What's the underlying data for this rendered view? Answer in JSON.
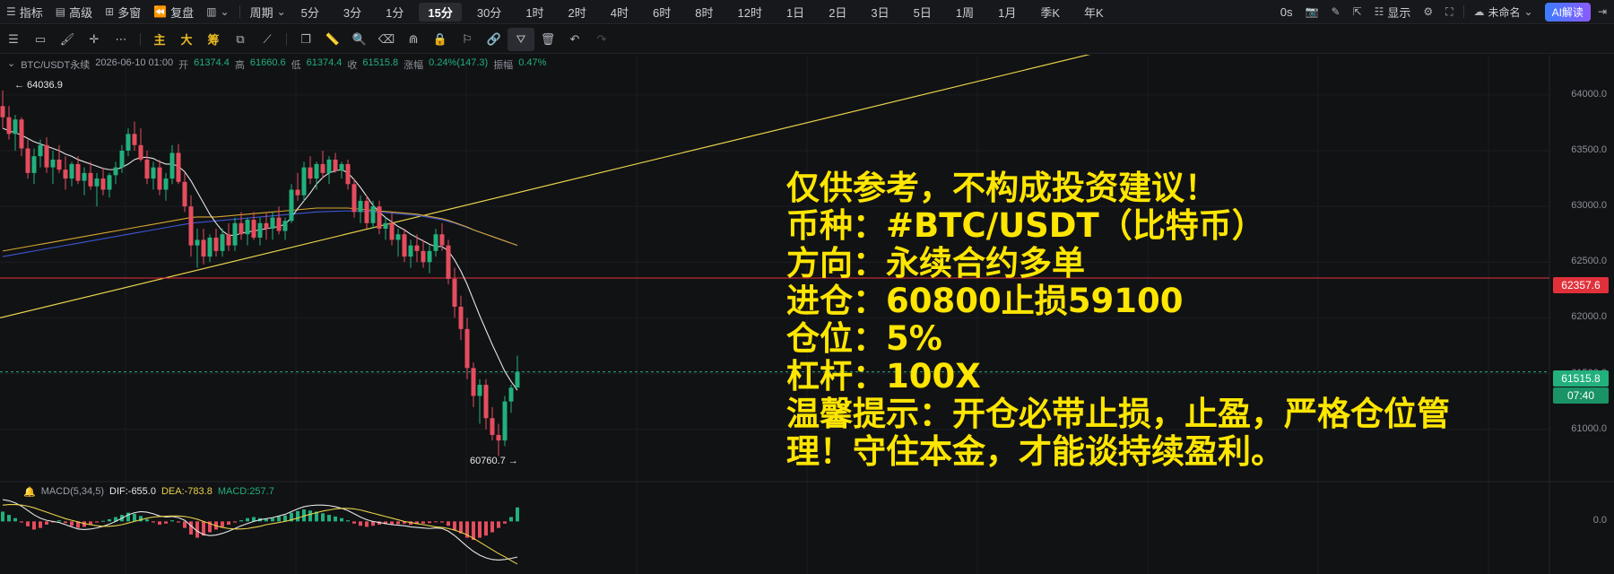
{
  "toolbar": {
    "indicators": "指标",
    "advanced": "高级",
    "multi_window": "多窗",
    "replay": "复盘",
    "period": "周期",
    "periods": [
      "5分",
      "3分",
      "1分",
      "15分",
      "30分",
      "1时",
      "2时",
      "4时",
      "6时",
      "8时",
      "12时",
      "1日",
      "2日",
      "3日",
      "5日",
      "1周",
      "1月",
      "季K",
      "年K"
    ],
    "active_period": "15分",
    "countdown": "0s",
    "display": "显示",
    "layout_name": "未命名",
    "ai_button": "AI解读"
  },
  "drawing_tools": {
    "main": "主",
    "big": "大",
    "chips": "筹"
  },
  "legend": {
    "symbol": "BTC/USDT永续",
    "datetime": "2026-06-10 01:00",
    "open_label": "开",
    "open": "61374.4",
    "high_label": "高",
    "high": "61660.6",
    "low_label": "低",
    "low": "61374.4",
    "close_label": "收",
    "close": "61515.8",
    "change_label": "涨幅",
    "change": "0.24%(147.3)",
    "amplitude_label": "振幅",
    "amplitude": "0.47%"
  },
  "price_axis": [
    "64000.0",
    "63500.0",
    "63000.0",
    "62500.0",
    "62000.0",
    "61500.0",
    "61000.0"
  ],
  "macd_axis": "0.0",
  "tags": {
    "red_line_price": "62357.6",
    "current_price": "61515.8",
    "countdown": "07:40"
  },
  "extremes": {
    "high": "← 64036.9",
    "low": "60760.7 →"
  },
  "overlay_lines": [
    "仅供参考，不构成投资建议！",
    "币种：#BTC/USDT（比特币）",
    "方向：永续合约多单",
    "进仓：60800止损59100",
    "仓位：5%",
    "杠杆：100X",
    "温馨提示：开仓必带止损，止盈，严格仓位管",
    "理！守住本金，才能谈持续盈利。"
  ],
  "macd": {
    "name": "MACD(5,34,5)",
    "dif": "DIF:-655.0",
    "dea": "DEA:-783.8",
    "macd": "MACD:257.7"
  },
  "colors": {
    "up": "#22b07d",
    "down": "#e54d5e",
    "ma_short": "#e6e6e6",
    "ma_mid": "#d6a631",
    "ma_long": "#3b56d6",
    "trendline": "#e8d24a",
    "level_line": "#e0313b",
    "overlay_text": "#ffe600"
  },
  "price_data": {
    "ohlc": [
      [
        63900,
        64040,
        63700,
        63800
      ],
      [
        63800,
        63900,
        63600,
        63650
      ],
      [
        63650,
        63820,
        63500,
        63780
      ],
      [
        63780,
        63800,
        63450,
        63520
      ],
      [
        63520,
        63600,
        63250,
        63300
      ],
      [
        63300,
        63520,
        63200,
        63450
      ],
      [
        63450,
        63600,
        63350,
        63550
      ],
      [
        63550,
        63620,
        63300,
        63350
      ],
      [
        63350,
        63500,
        63200,
        63420
      ],
      [
        63420,
        63550,
        63300,
        63330
      ],
      [
        63330,
        63450,
        63150,
        63250
      ],
      [
        63250,
        63400,
        63180,
        63380
      ],
      [
        63380,
        63450,
        63200,
        63230
      ],
      [
        63230,
        63350,
        63100,
        63300
      ],
      [
        63300,
        63400,
        63150,
        63180
      ],
      [
        63180,
        63300,
        63000,
        63250
      ],
      [
        63250,
        63350,
        63100,
        63150
      ],
      [
        63150,
        63300,
        63080,
        63280
      ],
      [
        63280,
        63400,
        63200,
        63350
      ],
      [
        63350,
        63550,
        63300,
        63500
      ],
      [
        63500,
        63700,
        63450,
        63650
      ],
      [
        63650,
        63760,
        63500,
        63550
      ],
      [
        63550,
        63700,
        63400,
        63420
      ],
      [
        63420,
        63500,
        63200,
        63250
      ],
      [
        63250,
        63400,
        63150,
        63350
      ],
      [
        63350,
        63420,
        63100,
        63150
      ],
      [
        63150,
        63300,
        63050,
        63250
      ],
      [
        63250,
        63550,
        63200,
        63480
      ],
      [
        63480,
        63560,
        63200,
        63220
      ],
      [
        63220,
        63300,
        62950,
        63000
      ],
      [
        63000,
        63100,
        62550,
        62650
      ],
      [
        62650,
        62800,
        62450,
        62700
      ],
      [
        62700,
        62800,
        62480,
        62550
      ],
      [
        62550,
        62750,
        62500,
        62720
      ],
      [
        62720,
        62800,
        62550,
        62600
      ],
      [
        62600,
        62800,
        62550,
        62750
      ],
      [
        62750,
        62850,
        62600,
        62650
      ],
      [
        62650,
        62900,
        62600,
        62850
      ],
      [
        62850,
        62950,
        62700,
        62750
      ],
      [
        62750,
        62900,
        62650,
        62880
      ],
      [
        62880,
        62950,
        62700,
        62720
      ],
      [
        62720,
        62900,
        62650,
        62850
      ],
      [
        62850,
        62950,
        62700,
        62800
      ],
      [
        62800,
        62950,
        62700,
        62900
      ],
      [
        62900,
        63000,
        62750,
        62780
      ],
      [
        62780,
        62900,
        62700,
        62870
      ],
      [
        62870,
        63200,
        62850,
        63150
      ],
      [
        63150,
        63300,
        63050,
        63100
      ],
      [
        63100,
        63400,
        63050,
        63350
      ],
      [
        63350,
        63450,
        63200,
        63250
      ],
      [
        63250,
        63400,
        63150,
        63380
      ],
      [
        63380,
        63500,
        63250,
        63300
      ],
      [
        63300,
        63450,
        63200,
        63420
      ],
      [
        63420,
        63480,
        63300,
        63320
      ],
      [
        63320,
        63400,
        63250,
        63380
      ],
      [
        63380,
        63420,
        63150,
        63200
      ],
      [
        63200,
        63250,
        62900,
        62950
      ],
      [
        62950,
        63100,
        62850,
        63050
      ],
      [
        63050,
        63100,
        62800,
        62850
      ],
      [
        62850,
        63050,
        62800,
        63000
      ],
      [
        63000,
        63050,
        62750,
        62800
      ],
      [
        62800,
        62900,
        62700,
        62850
      ],
      [
        62850,
        62950,
        62650,
        62700
      ],
      [
        62700,
        62800,
        62550,
        62750
      ],
      [
        62750,
        62800,
        62500,
        62550
      ],
      [
        62550,
        62700,
        62450,
        62650
      ],
      [
        62650,
        62750,
        62500,
        62600
      ],
      [
        62600,
        62700,
        62450,
        62500
      ],
      [
        62500,
        62650,
        62400,
        62600
      ],
      [
        62600,
        62800,
        62550,
        62750
      ],
      [
        62750,
        62850,
        62600,
        62650
      ],
      [
        62650,
        62700,
        62300,
        62350
      ],
      [
        62350,
        62450,
        62000,
        62100
      ],
      [
        62100,
        62200,
        61800,
        61900
      ],
      [
        61900,
        62000,
        61450,
        61550
      ],
      [
        61550,
        61600,
        61200,
        61300
      ],
      [
        61300,
        61450,
        61050,
        61400
      ],
      [
        61400,
        61450,
        61000,
        61100
      ],
      [
        61100,
        61200,
        60900,
        60950
      ],
      [
        60950,
        61050,
        60760,
        60900
      ],
      [
        60900,
        61300,
        60850,
        61250
      ],
      [
        61250,
        61400,
        61150,
        61374
      ],
      [
        61374,
        61660,
        61374,
        61516
      ]
    ],
    "ma_short": [
      63700,
      63680,
      63660,
      63640,
      63610,
      63580,
      63560,
      63540,
      63520,
      63500,
      63470,
      63450,
      63420,
      63400,
      63380,
      63360,
      63340,
      63330,
      63330,
      63350,
      63380,
      63420,
      63440,
      63440,
      63430,
      63400,
      63380,
      63380,
      63360,
      63310,
      63230,
      63130,
      63030,
      62930,
      62850,
      62780,
      62740,
      62740,
      62760,
      62770,
      62780,
      62790,
      62800,
      62810,
      62820,
      62840,
      62900,
      62980,
      63050,
      63120,
      63200,
      63260,
      63300,
      63320,
      63330,
      63300,
      63240,
      63170,
      63090,
      63010,
      62950,
      62900,
      62860,
      62820,
      62790,
      62750,
      62720,
      62690,
      62660,
      62640,
      62640,
      62600,
      62520,
      62420,
      62300,
      62160,
      62020,
      61890,
      61760,
      61640,
      61520,
      61430,
      61350
    ],
    "ma_mid": [
      62600,
      62610,
      62620,
      62630,
      62640,
      62650,
      62660,
      62670,
      62680,
      62690,
      62700,
      62710,
      62720,
      62730,
      62740,
      62750,
      62760,
      62770,
      62780,
      62790,
      62800,
      62810,
      62820,
      62830,
      62840,
      62850,
      62860,
      62870,
      62880,
      62890,
      62900,
      62905,
      62905,
      62905,
      62905,
      62910,
      62915,
      62920,
      62925,
      62930,
      62935,
      62940,
      62945,
      62950,
      62955,
      62960,
      62965,
      62970,
      62975,
      62980,
      62985,
      62985,
      62985,
      62985,
      62985,
      62985,
      62980,
      62975,
      62970,
      62965,
      62960,
      62955,
      62950,
      62945,
      62940,
      62935,
      62930,
      62920,
      62910,
      62900,
      62890,
      62875,
      62855,
      62835,
      62815,
      62790,
      62770,
      62750,
      62730,
      62710,
      62690,
      62670,
      62650
    ],
    "ma_long": [
      62550,
      62560,
      62570,
      62580,
      62590,
      62600,
      62610,
      62620,
      62630,
      62640,
      62650,
      62660,
      62670,
      62680,
      62690,
      62700,
      62710,
      62720,
      62730,
      62740,
      62750,
      62760,
      62770,
      62780,
      62790,
      62800,
      62810,
      62820,
      62830,
      62840,
      62850,
      62855,
      62860,
      62865,
      62870,
      62875,
      62880,
      62885,
      62890,
      62895,
      62900,
      62905,
      62910,
      62915,
      62920,
      62925,
      62930,
      62935,
      62940,
      62945,
      62950,
      62952,
      62954,
      62956,
      62958,
      62960,
      62958,
      62956,
      62954,
      62952,
      62950,
      62945,
      62940,
      62935,
      62930,
      62925,
      62920,
      62910,
      62900,
      62890,
      62880,
      62865,
      62850,
      62830,
      62810,
      62790,
      62770,
      62750,
      62730,
      62710,
      62690,
      62670,
      62650
    ],
    "trendline": [
      [
        0,
        62000
      ],
      [
        1285,
        64500
      ]
    ],
    "level_price": 62357.6,
    "current_price": 61515.8,
    "ylim": [
      60700,
      64200
    ]
  },
  "macd_data": {
    "hist": [
      180,
      120,
      60,
      -20,
      -90,
      -150,
      -120,
      -60,
      -20,
      20,
      -30,
      -80,
      -120,
      -100,
      -60,
      -20,
      10,
      40,
      80,
      120,
      160,
      140,
      100,
      40,
      -20,
      -60,
      -40,
      20,
      -20,
      -120,
      -240,
      -300,
      -260,
      -200,
      -150,
      -100,
      -60,
      -20,
      20,
      60,
      80,
      60,
      40,
      60,
      90,
      110,
      160,
      190,
      220,
      200,
      180,
      150,
      120,
      90,
      60,
      20,
      -40,
      -80,
      -100,
      -80,
      -60,
      -50,
      -60,
      -50,
      -40,
      -60,
      -50,
      -40,
      -30,
      -10,
      -20,
      -80,
      -160,
      -220,
      -300,
      -340,
      -300,
      -260,
      -200,
      -120,
      -40,
      80,
      257
    ],
    "dif": [
      400,
      380,
      340,
      280,
      200,
      120,
      60,
      20,
      0,
      -20,
      -60,
      -100,
      -140,
      -150,
      -140,
      -120,
      -90,
      -50,
      0,
      60,
      120,
      160,
      180,
      170,
      140,
      100,
      80,
      90,
      70,
      20,
      -80,
      -180,
      -240,
      -260,
      -250,
      -220,
      -180,
      -130,
      -80,
      -40,
      0,
      30,
      50,
      70,
      100,
      130,
      180,
      230,
      270,
      290,
      300,
      300,
      290,
      270,
      240,
      200,
      140,
      80,
      30,
      0,
      -20,
      -40,
      -60,
      -70,
      -80,
      -100,
      -110,
      -120,
      -130,
      -120,
      -130,
      -180,
      -260,
      -360,
      -460,
      -550,
      -620,
      -670,
      -700,
      -710,
      -700,
      -680,
      -655
    ],
    "dea": [
      300,
      310,
      310,
      300,
      280,
      250,
      210,
      170,
      130,
      90,
      50,
      20,
      -10,
      -40,
      -60,
      -80,
      -90,
      -90,
      -80,
      -60,
      -30,
      0,
      30,
      60,
      80,
      90,
      95,
      100,
      100,
      90,
      70,
      40,
      0,
      -40,
      -80,
      -110,
      -130,
      -140,
      -140,
      -130,
      -110,
      -90,
      -60,
      -40,
      -20,
      0,
      30,
      60,
      100,
      130,
      160,
      190,
      210,
      230,
      240,
      240,
      230,
      210,
      180,
      150,
      120,
      90,
      60,
      30,
      0,
      -20,
      -40,
      -60,
      -80,
      -100,
      -110,
      -130,
      -160,
      -200,
      -250,
      -310,
      -380,
      -450,
      -520,
      -590,
      -650,
      -720,
      -783.8
    ],
    "ylim": [
      -900,
      500
    ]
  }
}
